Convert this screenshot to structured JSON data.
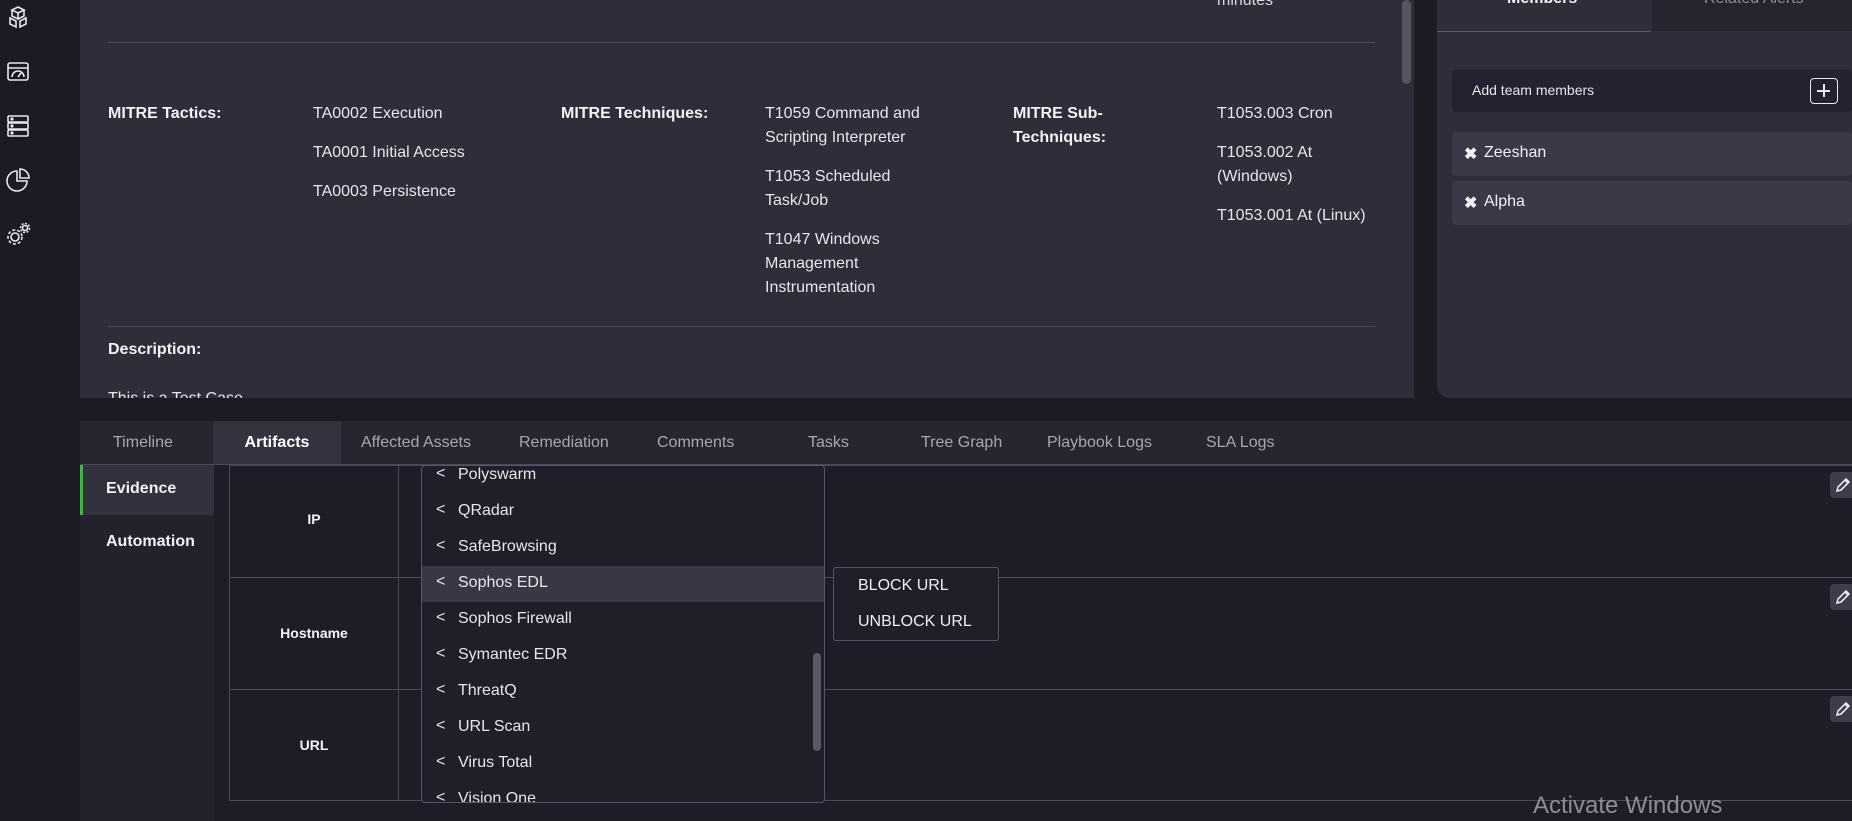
{
  "rail": {
    "icons": [
      "cubes-icon",
      "dashboard-icon",
      "database-icon",
      "pie-chart-icon",
      "settings-icon"
    ]
  },
  "details": {
    "minutes_text": "minutes",
    "mitre_tactics_label": "MITRE Tactics:",
    "mitre_tactics": [
      "TA0002 Execution",
      "TA0001 Initial Access",
      "TA0003 Persistence"
    ],
    "mitre_techniques_label": "MITRE Techniques:",
    "mitre_techniques": [
      "T1059 Command and Scripting Interpreter",
      "T1053 Scheduled Task/Job",
      "T1047 Windows Management Instrumentation"
    ],
    "mitre_subtechniques_label": "MITRE Sub-Techniques:",
    "mitre_subtechniques": [
      "T1053.003 Cron",
      "T1053.002 At (Windows)",
      "T1053.001 At (Linux)"
    ],
    "description_label": "Description:",
    "description_text": "This is a Test Case"
  },
  "members_panel": {
    "tab_members": "Members",
    "tab_related": "Related Alerts",
    "add_team_label": "Add team members",
    "members": [
      "Zeeshan",
      "Alpha"
    ]
  },
  "tabs": [
    "Timeline",
    "Artifacts",
    "Affected Assets",
    "Remediation",
    "Comments",
    "Tasks",
    "Tree Graph",
    "Playbook Logs",
    "SLA Logs"
  ],
  "active_tab": "Artifacts",
  "subnav": {
    "items": [
      "Evidence",
      "Automation"
    ],
    "active": "Evidence"
  },
  "artifact_types": [
    "IP",
    "Hostname",
    "URL"
  ],
  "integrations": [
    "Polyswarm",
    "QRadar",
    "SafeBrowsing",
    "Sophos EDL",
    "Sophos Firewall",
    "Symantec EDR",
    "ThreatQ",
    "URL Scan",
    "Virus Total",
    "Vision One"
  ],
  "highlighted_integration": "Sophos EDL",
  "submenu": [
    "BLOCK URL",
    "UNBLOCK URL"
  ],
  "watermark": "Activate Windows",
  "colors": {
    "accent_green": "#4caf50",
    "panel_bg": "#2e2d3a",
    "page_bg": "#1b1b23"
  }
}
